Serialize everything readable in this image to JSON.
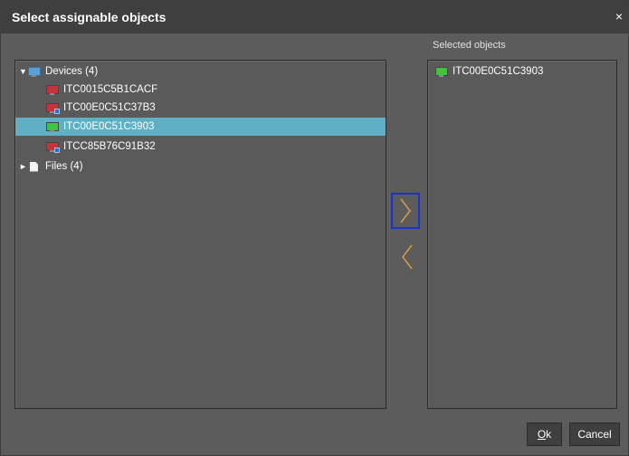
{
  "dialog": {
    "title": "Select assignable objects",
    "close_glyph": "×"
  },
  "left_tree": {
    "devices_label": "Devices (4)",
    "files_label": "Files (4)",
    "expanded_arrow": "▼",
    "collapsed_arrow": "►",
    "devices": [
      {
        "label": "ITC0015C5B1CACF",
        "status_color": "#c8323a",
        "badge": false,
        "selected": false
      },
      {
        "label": "ITC00E0C51C37B3",
        "status_color": "#c8323a",
        "badge": true,
        "selected": false
      },
      {
        "label": "ITC00E0C51C3903",
        "status_color": "#3ec43e",
        "badge": false,
        "selected": true
      },
      {
        "label": "ITCC85B76C91B32",
        "status_color": "#c8323a",
        "badge": true,
        "selected": false
      }
    ]
  },
  "right_panel": {
    "label": "Selected objects",
    "items": [
      {
        "label": "ITC00E0C51C3903",
        "status_color": "#3ec43e"
      }
    ]
  },
  "move_buttons": {
    "add_icon": "chevron-right-icon",
    "remove_icon": "chevron-left-icon",
    "arrow_color": "#d79a4a"
  },
  "footer": {
    "ok_mnemonic": "O",
    "ok_rest": "k",
    "cancel_label": "Cancel"
  },
  "colors": {
    "background": "#5c5c5c",
    "titlebar": "#3f3f3f",
    "selection": "#5fb0c4",
    "focus_border": "#1c2fd0"
  }
}
